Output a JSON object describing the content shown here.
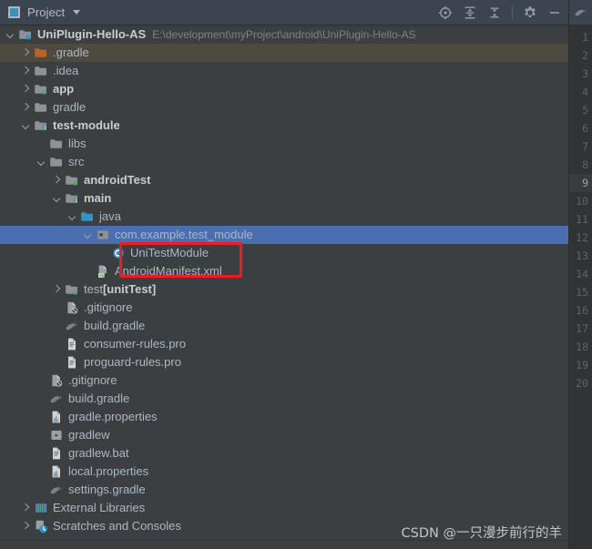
{
  "toolbar": {
    "title": "Project",
    "project_icon": "project-panel-icon",
    "dropdown_icon": "chevron-down-icon",
    "actions": [
      {
        "name": "select-opened-file-icon",
        "label": "Select Opened File"
      },
      {
        "name": "expand-all-icon",
        "label": "Expand All"
      },
      {
        "name": "collapse-all-icon",
        "label": "Collapse All"
      },
      {
        "name": "settings-gear-icon",
        "label": "Settings"
      },
      {
        "name": "hide-panel-icon",
        "label": "Hide"
      }
    ]
  },
  "gutter": {
    "file_icon": "gradle-file-icon",
    "current_line": 9,
    "line_numbers": [
      1,
      2,
      3,
      4,
      5,
      6,
      7,
      8,
      9,
      10,
      11,
      12,
      13,
      14,
      15,
      16,
      17,
      18,
      19,
      20
    ]
  },
  "annotation": {
    "color": "#ee1c25",
    "target_label": "UniTestModule"
  },
  "watermark": {
    "text": "CSDN @一只漫步前行的羊"
  },
  "colors": {
    "selection": "#4b6eaf",
    "hover": "#4e4a3f",
    "background": "#3c3f41",
    "toolbar": "#3c4450",
    "gutter": "#313335",
    "annotation": "#ee1c25"
  },
  "tree": {
    "rows": [
      {
        "indent": 0,
        "arrow": "expanded",
        "icon": "module-root-icon",
        "label": "UniPlugin-Hello-AS",
        "bold": true,
        "path": "E:\\development\\myProject\\android\\UniPlugin-Hello-AS",
        "state": "normal"
      },
      {
        "indent": 1,
        "arrow": "collapsed",
        "icon": "folder-orange-icon",
        "label": ".gradle",
        "bold": false,
        "state": "hover"
      },
      {
        "indent": 1,
        "arrow": "collapsed",
        "icon": "folder-icon",
        "label": ".idea",
        "bold": false,
        "state": "normal"
      },
      {
        "indent": 1,
        "arrow": "collapsed",
        "icon": "module-icon",
        "label": "app",
        "bold": true,
        "state": "normal"
      },
      {
        "indent": 1,
        "arrow": "collapsed",
        "icon": "folder-icon",
        "label": "gradle",
        "bold": false,
        "state": "normal"
      },
      {
        "indent": 1,
        "arrow": "expanded",
        "icon": "module-gradle-icon",
        "label": "test-module",
        "bold": true,
        "state": "normal"
      },
      {
        "indent": 2,
        "arrow": "none",
        "icon": "folder-icon",
        "label": "libs",
        "bold": false,
        "state": "normal"
      },
      {
        "indent": 2,
        "arrow": "expanded",
        "icon": "folder-icon",
        "label": "src",
        "bold": false,
        "state": "normal"
      },
      {
        "indent": 3,
        "arrow": "collapsed",
        "icon": "source-test-folder-icon",
        "label": "androidTest",
        "bold": true,
        "state": "normal"
      },
      {
        "indent": 3,
        "arrow": "expanded",
        "icon": "module-gradle-icon",
        "label": "main",
        "bold": true,
        "state": "normal"
      },
      {
        "indent": 4,
        "arrow": "expanded",
        "icon": "source-folder-icon",
        "label": "java",
        "bold": false,
        "state": "normal"
      },
      {
        "indent": 5,
        "arrow": "expanded",
        "icon": "package-icon",
        "label": "com.example.test_module",
        "bold": false,
        "state": "selected"
      },
      {
        "indent": 6,
        "arrow": "none",
        "icon": "java-class-icon",
        "label": "UniTestModule",
        "bold": false,
        "state": "normal"
      },
      {
        "indent": 5,
        "arrow": "none",
        "icon": "manifest-file-icon",
        "label": "AndroidManifest.xml",
        "bold": false,
        "state": "normal"
      },
      {
        "indent": 3,
        "arrow": "collapsed",
        "icon": "source-test-folder-icon",
        "label": "test ",
        "suffix": "[unitTest]",
        "bold": false,
        "state": "normal"
      },
      {
        "indent": 3,
        "arrow": "none",
        "icon": "gitignore-file-icon",
        "label": ".gitignore",
        "bold": false,
        "state": "normal"
      },
      {
        "indent": 3,
        "arrow": "none",
        "icon": "gradle-file-icon",
        "label": "build.gradle",
        "bold": false,
        "state": "normal"
      },
      {
        "indent": 3,
        "arrow": "none",
        "icon": "text-file-icon",
        "label": "consumer-rules.pro",
        "bold": false,
        "state": "normal"
      },
      {
        "indent": 3,
        "arrow": "none",
        "icon": "text-file-icon",
        "label": "proguard-rules.pro",
        "bold": false,
        "state": "normal"
      },
      {
        "indent": 2,
        "arrow": "none",
        "icon": "gitignore-file-icon",
        "label": ".gitignore",
        "bold": false,
        "state": "normal"
      },
      {
        "indent": 2,
        "arrow": "none",
        "icon": "gradle-file-icon",
        "label": "build.gradle",
        "bold": false,
        "state": "normal"
      },
      {
        "indent": 2,
        "arrow": "none",
        "icon": "properties-file-icon",
        "label": "gradle.properties",
        "bold": false,
        "state": "normal"
      },
      {
        "indent": 2,
        "arrow": "none",
        "icon": "script-file-icon",
        "label": "gradlew",
        "bold": false,
        "state": "normal"
      },
      {
        "indent": 2,
        "arrow": "none",
        "icon": "text-file-icon",
        "label": "gradlew.bat",
        "bold": false,
        "state": "normal"
      },
      {
        "indent": 2,
        "arrow": "none",
        "icon": "properties-file-icon",
        "label": "local.properties",
        "bold": false,
        "state": "normal"
      },
      {
        "indent": 2,
        "arrow": "none",
        "icon": "gradle-file-icon",
        "label": "settings.gradle",
        "bold": false,
        "state": "normal"
      },
      {
        "indent": 1,
        "arrow": "collapsed",
        "icon": "external-libraries-icon",
        "label": "External Libraries",
        "bold": false,
        "state": "normal"
      },
      {
        "indent": 1,
        "arrow": "collapsed",
        "icon": "scratches-icon",
        "label": "Scratches and Consoles",
        "bold": false,
        "state": "normal"
      }
    ]
  }
}
